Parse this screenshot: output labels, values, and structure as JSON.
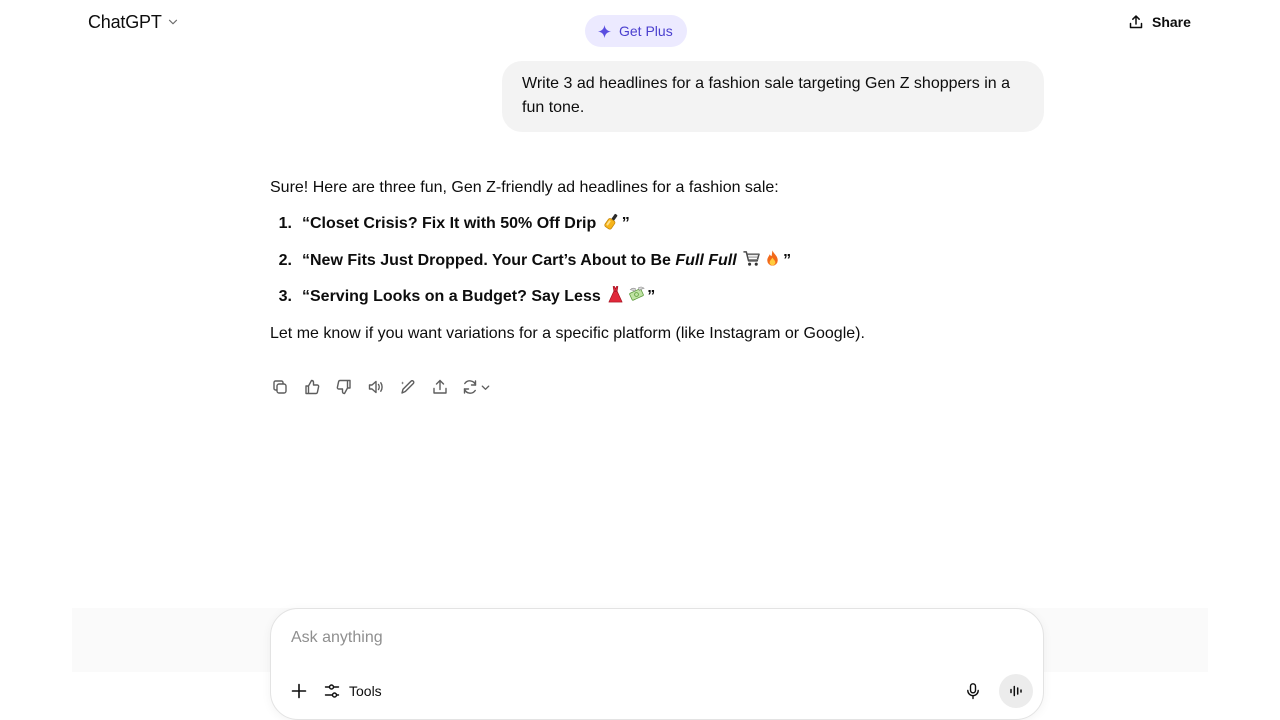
{
  "header": {
    "model_label": "ChatGPT",
    "upgrade_label": "Get Plus",
    "share_label": "Share"
  },
  "conversation": {
    "user_message": "Write 3 ad headlines for a fashion sale targeting Gen Z shoppers in a fun tone.",
    "assistant": {
      "intro": "Sure! Here are three fun, Gen Z-friendly ad headlines for a fashion sale:",
      "headlines": [
        {
          "number": "1.",
          "text": "“Closet Crisis? Fix It with 50% Off Drip",
          "emojis": [
            "nail-polish-emoji"
          ],
          "closing": "”"
        },
        {
          "number": "2.",
          "text_before": "“New Fits Just Dropped. Your Cart’s About to Be ",
          "text_italic": "Full Full",
          "emojis": [
            "shopping-cart-emoji",
            "fire-emoji"
          ],
          "closing": "”"
        },
        {
          "number": "3.",
          "text": "“Serving Looks on a Budget? Say Less",
          "emojis": [
            "dress-emoji",
            "money-with-wings-emoji"
          ],
          "closing": "”"
        }
      ],
      "outro": "Let me know if you want variations for a specific platform (like Instagram or Google)."
    },
    "actions": [
      "copy-icon",
      "thumbs-up-icon",
      "thumbs-down-icon",
      "read-aloud-icon",
      "edit-icon",
      "share-icon",
      "regenerate-icon"
    ]
  },
  "composer": {
    "placeholder": "Ask anything",
    "value": "",
    "tools_label": "Tools"
  },
  "colors": {
    "accent": "#4a3fcf",
    "accent_bg": "#eceaff",
    "bubble_bg": "#f3f3f3"
  }
}
